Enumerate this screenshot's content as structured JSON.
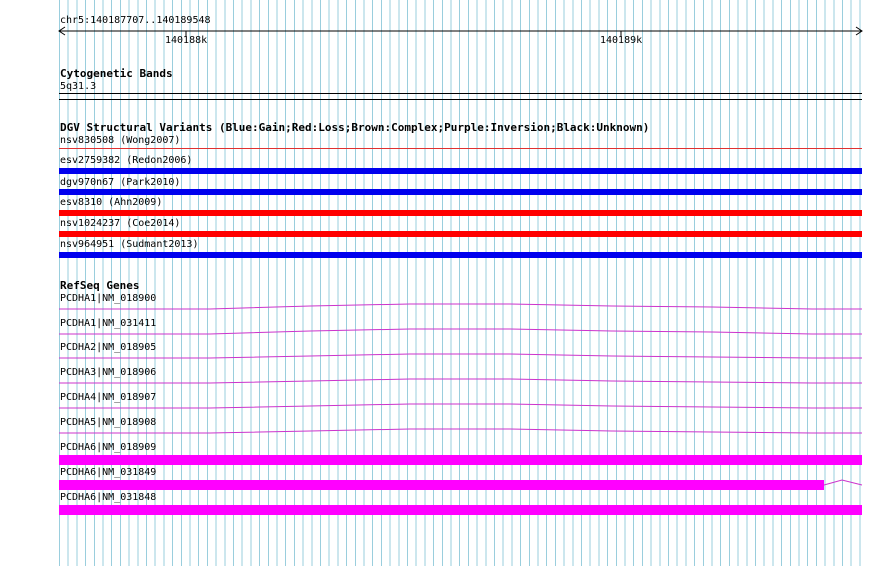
{
  "ruler": {
    "region": "chr5:140187707..140189548",
    "ticks": [
      {
        "label": "140188k",
        "pos": 140188000
      },
      {
        "label": "140189k",
        "pos": 140189000
      }
    ],
    "start": 140187707,
    "end": 140189548
  },
  "tracks": {
    "cyto": {
      "title": "Cytogenetic Bands",
      "band": "5q31.3"
    },
    "dgv": {
      "title": "DGV Structural Variants (Blue:Gain;Red:Loss;Brown:Complex;Purple:Inversion;Black:Unknown)",
      "features": [
        {
          "label": "nsv830508 (Wong2007)",
          "type": "Loss",
          "color": "#e03030"
        },
        {
          "label": "esv2759382 (Redon2006)",
          "type": "Gain",
          "color": "#0000ee"
        },
        {
          "label": "dgv970n67 (Park2010)",
          "type": "Gain",
          "color": "#0000ee"
        },
        {
          "label": "esv8310 (Ahn2009)",
          "type": "Loss",
          "color": "#ff0000"
        },
        {
          "label": "nsv1024237 (Coe2014)",
          "type": "Loss",
          "color": "#ff0000"
        },
        {
          "label": "nsv964951 (Sudmant2013)",
          "type": "Gain",
          "color": "#0000ee"
        }
      ]
    },
    "refseq": {
      "title": "RefSeq Genes",
      "color": "#ff00ff",
      "genes": [
        {
          "label": "PCDHA1|NM_018900"
        },
        {
          "label": "PCDHA1|NM_031411"
        },
        {
          "label": "PCDHA2|NM_018905"
        },
        {
          "label": "PCDHA3|NM_018906"
        },
        {
          "label": "PCDHA4|NM_018907"
        },
        {
          "label": "PCDHA5|NM_018908"
        },
        {
          "label": "PCDHA6|NM_018909"
        },
        {
          "label": "PCDHA6|NM_031849"
        },
        {
          "label": "PCDHA6|NM_031848"
        }
      ]
    }
  }
}
